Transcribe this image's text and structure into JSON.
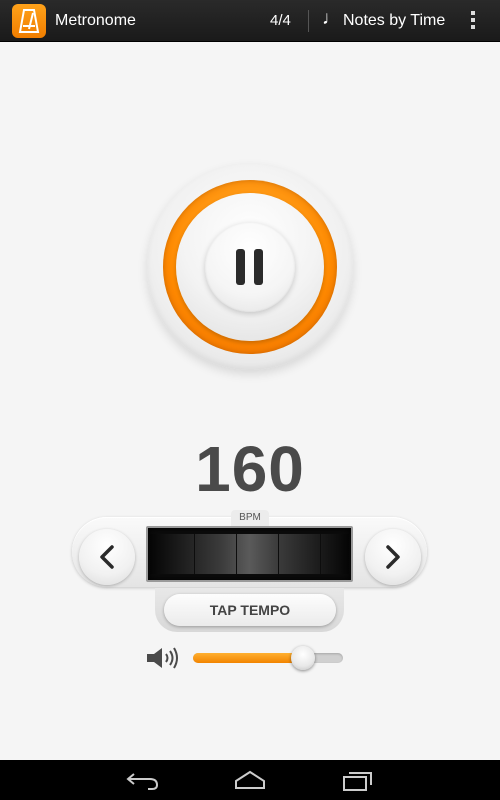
{
  "action_bar": {
    "app_title": "Metronome",
    "time_signature": "4/4",
    "notes_label": "Notes by Time",
    "app_icon": "metronome-icon",
    "note_icon": "quarter-note-icon",
    "overflow_icon": "more-vertical-icon"
  },
  "player": {
    "state": "playing",
    "button_icon": "pause-icon",
    "accent_color": "#ff8a00"
  },
  "tempo": {
    "bpm": "160",
    "unit_label": "BPM",
    "decrease_icon": "chevron-left-icon",
    "increase_icon": "chevron-right-icon",
    "tap_label": "TAP TEMPO"
  },
  "volume": {
    "icon": "speaker-icon",
    "level": 0.73
  },
  "nav_bar": {
    "back_icon": "back-icon",
    "home_icon": "home-icon",
    "recent_icon": "recent-apps-icon"
  }
}
